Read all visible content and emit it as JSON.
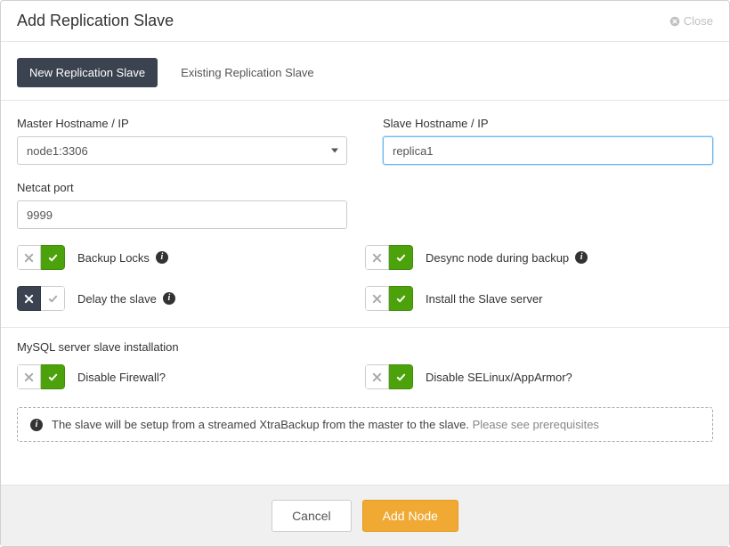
{
  "header": {
    "title": "Add Replication Slave",
    "close_label": "Close"
  },
  "tabs": {
    "new": "New Replication Slave",
    "existing": "Existing Replication Slave"
  },
  "fields": {
    "master_label": "Master Hostname / IP",
    "master_value": "node1:3306",
    "slave_label": "Slave Hostname / IP",
    "slave_value": "replica1",
    "netcat_label": "Netcat port",
    "netcat_value": "9999"
  },
  "toggles": {
    "backup_locks": {
      "label": "Backup Locks",
      "on": true,
      "info": true
    },
    "desync": {
      "label": "Desync node during backup",
      "on": true,
      "info": true
    },
    "delay_slave": {
      "label": "Delay the slave",
      "on": false,
      "info": true
    },
    "install_slave": {
      "label": "Install the Slave server",
      "on": true,
      "info": false
    }
  },
  "mysql_section": {
    "title": "MySQL server slave installation",
    "disable_firewall": {
      "label": "Disable Firewall?",
      "on": true
    },
    "disable_selinux": {
      "label": "Disable SELinux/AppArmor?",
      "on": true
    }
  },
  "note": {
    "text": "The slave will be setup from a streamed XtraBackup from the master to the slave.",
    "link": "Please see prerequisites"
  },
  "footer": {
    "cancel": "Cancel",
    "add": "Add Node"
  }
}
